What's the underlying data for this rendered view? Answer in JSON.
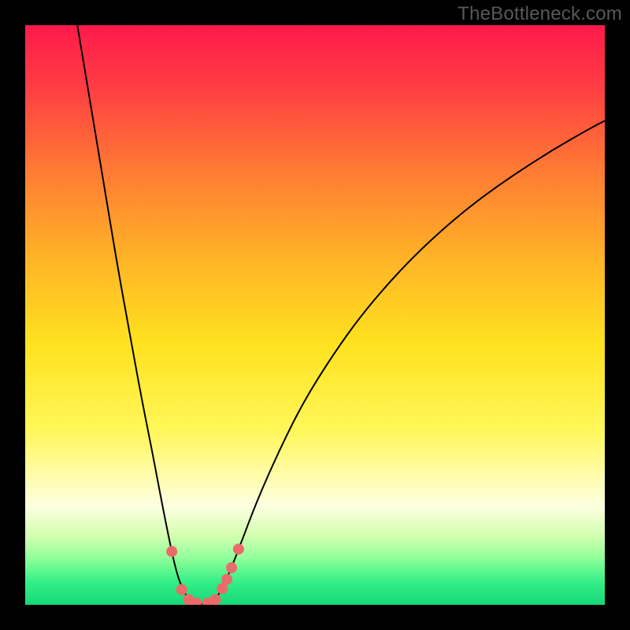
{
  "watermark": "TheBottleneck.com",
  "chart_data": {
    "type": "line",
    "title": "",
    "xlabel": "",
    "ylabel": "",
    "xlim": [
      0,
      100
    ],
    "ylim": [
      0,
      100
    ],
    "background_gradient": {
      "stops": [
        {
          "offset": 0.0,
          "color": "#ff1a4b"
        },
        {
          "offset": 0.1,
          "color": "#ff3b43"
        },
        {
          "offset": 0.25,
          "color": "#ff7a34"
        },
        {
          "offset": 0.4,
          "color": "#ffb327"
        },
        {
          "offset": 0.55,
          "color": "#ffe21f"
        },
        {
          "offset": 0.7,
          "color": "#fff75a"
        },
        {
          "offset": 0.78,
          "color": "#fffcae"
        },
        {
          "offset": 0.83,
          "color": "#fcffe0"
        },
        {
          "offset": 0.88,
          "color": "#d4ffb0"
        },
        {
          "offset": 0.92,
          "color": "#8fff9a"
        },
        {
          "offset": 0.96,
          "color": "#35ef87"
        },
        {
          "offset": 1.0,
          "color": "#16d877"
        }
      ]
    },
    "series": [
      {
        "name": "bottleneck-curve",
        "stroke": "#000000",
        "stroke_width": 2.0,
        "points": [
          {
            "x": 9.0,
            "y": 100.0
          },
          {
            "x": 10.0,
            "y": 94.0
          },
          {
            "x": 12.0,
            "y": 82.0
          },
          {
            "x": 14.0,
            "y": 70.0
          },
          {
            "x": 16.0,
            "y": 58.0
          },
          {
            "x": 18.0,
            "y": 47.0
          },
          {
            "x": 20.0,
            "y": 36.0
          },
          {
            "x": 22.0,
            "y": 26.0
          },
          {
            "x": 23.5,
            "y": 18.0
          },
          {
            "x": 25.0,
            "y": 10.5
          },
          {
            "x": 26.0,
            "y": 6.0
          },
          {
            "x": 27.0,
            "y": 3.0
          },
          {
            "x": 28.0,
            "y": 1.2
          },
          {
            "x": 29.0,
            "y": 0.4
          },
          {
            "x": 30.0,
            "y": 0.1
          },
          {
            "x": 31.0,
            "y": 0.1
          },
          {
            "x": 32.0,
            "y": 0.4
          },
          {
            "x": 33.0,
            "y": 1.2
          },
          {
            "x": 34.0,
            "y": 2.8
          },
          {
            "x": 35.0,
            "y": 5.0
          },
          {
            "x": 37.0,
            "y": 10.0
          },
          {
            "x": 40.0,
            "y": 18.0
          },
          {
            "x": 44.0,
            "y": 27.0
          },
          {
            "x": 48.0,
            "y": 35.0
          },
          {
            "x": 53.0,
            "y": 43.0
          },
          {
            "x": 58.0,
            "y": 50.0
          },
          {
            "x": 64.0,
            "y": 57.0
          },
          {
            "x": 70.0,
            "y": 63.0
          },
          {
            "x": 77.0,
            "y": 69.0
          },
          {
            "x": 84.0,
            "y": 74.0
          },
          {
            "x": 91.0,
            "y": 78.5
          },
          {
            "x": 98.0,
            "y": 82.5
          },
          {
            "x": 100.0,
            "y": 83.5
          }
        ]
      }
    ],
    "markers": {
      "name": "highlighted-points",
      "fill": "#ec6a6a",
      "radius": 7,
      "points": [
        {
          "x": 25.3,
          "y": 9.2
        },
        {
          "x": 27.0,
          "y": 2.6
        },
        {
          "x": 28.2,
          "y": 0.9
        },
        {
          "x": 29.5,
          "y": 0.3
        },
        {
          "x": 31.5,
          "y": 0.3
        },
        {
          "x": 32.8,
          "y": 0.9
        },
        {
          "x": 34.0,
          "y": 2.8
        },
        {
          "x": 34.8,
          "y": 4.4
        },
        {
          "x": 35.6,
          "y": 6.4
        },
        {
          "x": 36.8,
          "y": 9.6
        }
      ]
    }
  }
}
